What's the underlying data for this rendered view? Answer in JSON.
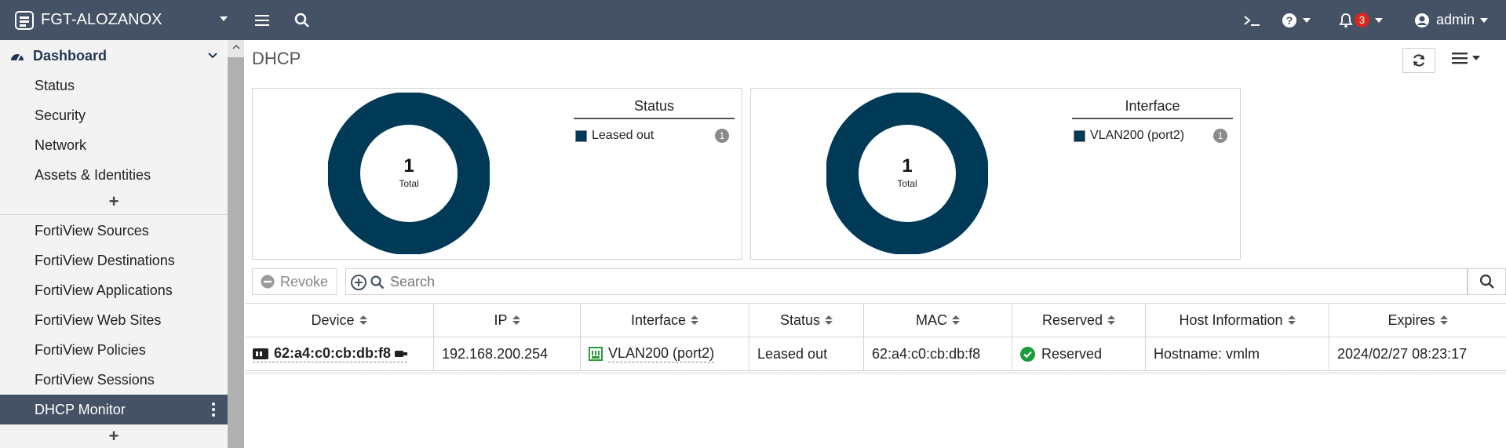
{
  "header": {
    "device_name": "FGT-ALOZANOX",
    "notification_count": "3",
    "user": "admin",
    "icons": [
      "fortigate-logo-icon",
      "menu-icon",
      "search-icon",
      "cli-console-icon",
      "help-icon",
      "bell-icon",
      "user-icon"
    ]
  },
  "sidebar": {
    "head": "Dashboard",
    "group1": [
      "Status",
      "Security",
      "Network",
      "Assets & Identities"
    ],
    "group2": [
      "FortiView Sources",
      "FortiView Destinations",
      "FortiView Applications",
      "FortiView Web Sites",
      "FortiView Policies",
      "FortiView Sessions",
      "DHCP Monitor"
    ],
    "active": "DHCP Monitor",
    "add_symbol": "+"
  },
  "main": {
    "title": "DHCP",
    "widgets": [
      {
        "center_value": "1",
        "center_label": "Total",
        "legend_title": "Status",
        "legend_item": "Leased out",
        "legend_count": "1",
        "color": "#003a56"
      },
      {
        "center_value": "1",
        "center_label": "Total",
        "legend_title": "Interface",
        "legend_item": "VLAN200 (port2)",
        "legend_count": "1",
        "color": "#003a56"
      }
    ],
    "toolbar": {
      "revoke_label": "Revoke",
      "search_placeholder": "Search"
    },
    "table": {
      "columns": [
        "Device",
        "IP",
        "Interface",
        "Status",
        "MAC",
        "Reserved",
        "Host Information",
        "Expires"
      ],
      "rows": [
        {
          "device": "62:a4:c0:cb:db:f8",
          "ip": "192.168.200.254",
          "interface": "VLAN200 (port2)",
          "status": "Leased out",
          "mac": "62:a4:c0:cb:db:f8",
          "reserved": "Reserved",
          "host": "Hostname: vmlm",
          "expires": "2024/02/27 08:23:17"
        }
      ]
    }
  },
  "colors": {
    "topbar": "#455266",
    "donut": "#003a56",
    "badge": "#d52b1e",
    "reserved_check": "#1a9b3a"
  }
}
